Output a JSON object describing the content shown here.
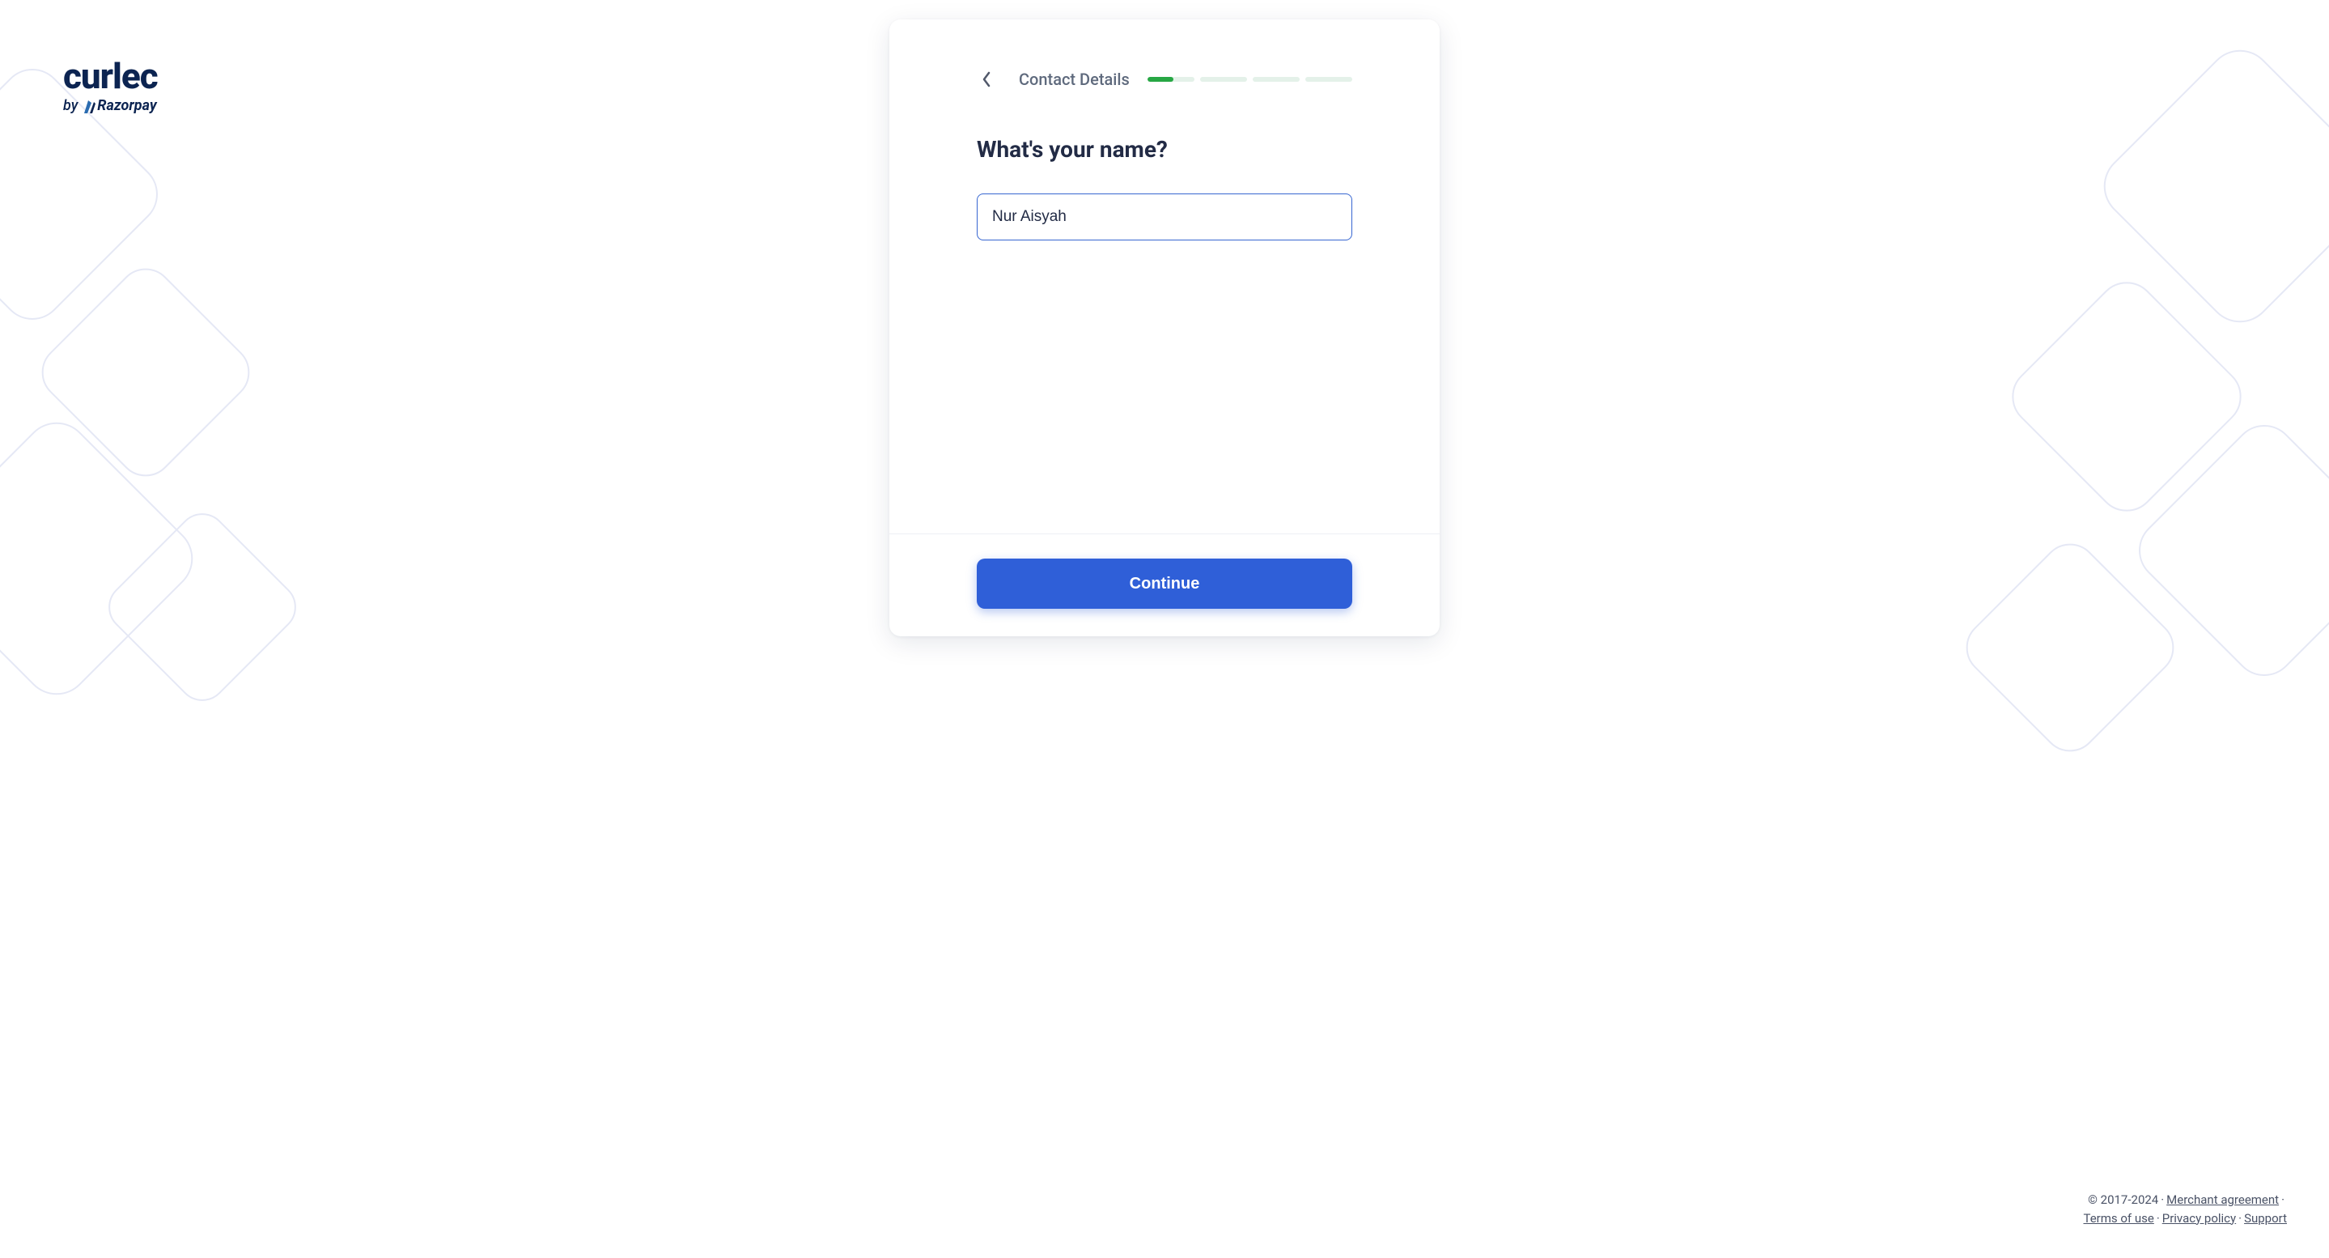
{
  "logo": {
    "brand": "curlec",
    "by": "by",
    "parent": "Razorpay"
  },
  "card": {
    "step_title": "Contact Details",
    "progress": {
      "current_step": 1,
      "total_steps": 4,
      "fill_percent": 55
    },
    "question": "What's your name?",
    "name_input": {
      "value": "Nur Aisyah",
      "placeholder": ""
    },
    "continue_label": "Continue"
  },
  "footer": {
    "copyright": "© 2017-2024",
    "links": {
      "merchant_agreement": "Merchant agreement",
      "terms": "Terms of use",
      "privacy": "Privacy policy",
      "support": "Support"
    }
  }
}
